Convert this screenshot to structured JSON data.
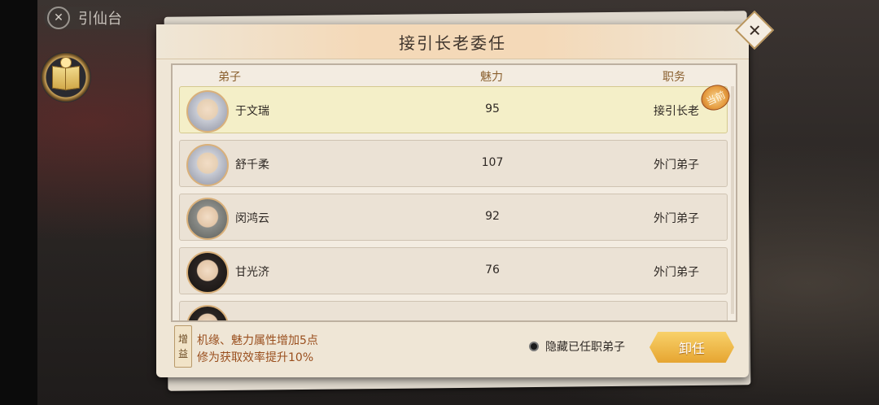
{
  "header": {
    "location_label": "引仙台",
    "close_icon": "close-icon"
  },
  "side": {
    "book_icon": "book-icon"
  },
  "dialog": {
    "title": "接引长老委任",
    "close_icon": "close-icon",
    "columns": [
      "弟子",
      "魅力",
      "职务"
    ],
    "rows": [
      {
        "name": "于文瑞",
        "charm": "95",
        "role": "接引长老",
        "selected": true,
        "badge": "当前"
      },
      {
        "name": "舒千柔",
        "charm": "107",
        "role": "外门弟子"
      },
      {
        "name": "闵鸿云",
        "charm": "92",
        "role": "外门弟子"
      },
      {
        "name": "甘光济",
        "charm": "76",
        "role": "外门弟子"
      }
    ],
    "buff_tag": [
      "增",
      "益"
    ],
    "buff_lines": [
      "机缘、魅力属性增加5点",
      "修为获取效率提升10%"
    ],
    "hide_assigned_label": "隐藏已任职弟子",
    "dismiss_label": "卸任"
  }
}
